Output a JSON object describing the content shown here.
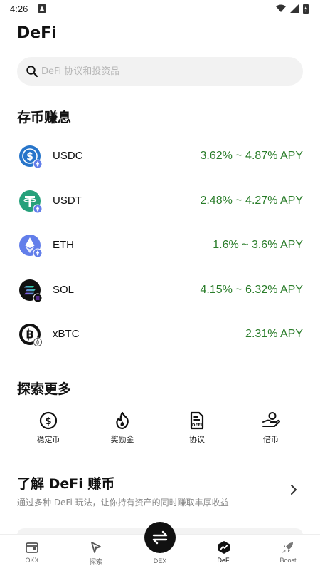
{
  "status_bar": {
    "time": "4:26"
  },
  "header": {
    "title": "DeFi"
  },
  "search": {
    "placeholder": "DeFi 协议和投资品"
  },
  "earn_section": {
    "title": "存币赚息",
    "assets": [
      {
        "name": "USDC",
        "apy": "3.62% ~ 4.87% APY",
        "icon": "usdc-coin-icon"
      },
      {
        "name": "USDT",
        "apy": "2.48% ~ 4.27% APY",
        "icon": "usdt-coin-icon"
      },
      {
        "name": "ETH",
        "apy": "1.6% ~ 3.6% APY",
        "icon": "eth-coin-icon"
      },
      {
        "name": "SOL",
        "apy": "4.15% ~ 6.32% APY",
        "icon": "sol-coin-icon"
      },
      {
        "name": "xBTC",
        "apy": "2.31% APY",
        "icon": "xbtc-coin-icon"
      }
    ]
  },
  "explore_section": {
    "title": "探索更多",
    "items": [
      {
        "label": "稳定币",
        "icon": "dollar-coin-icon"
      },
      {
        "label": "奖励金",
        "icon": "flame-icon"
      },
      {
        "label": "协议",
        "icon": "defi-document-icon"
      },
      {
        "label": "借币",
        "icon": "borrow-hand-icon"
      }
    ]
  },
  "learn_section": {
    "title": "了解 DeFi 赚币",
    "subtitle": "通过多种 DeFi 玩法，让你持有资产的同时赚取丰厚收益"
  },
  "tabbar": {
    "tabs": [
      {
        "label": "OKX",
        "icon": "wallet-icon"
      },
      {
        "label": "探索",
        "icon": "compass-icon"
      },
      {
        "label": "DEX",
        "icon": "swap-icon"
      },
      {
        "label": "DeFi",
        "icon": "defi-icon"
      },
      {
        "label": "Boost",
        "icon": "rocket-icon"
      }
    ],
    "active": "DeFi"
  },
  "colors": {
    "apy_green": "#2a7d2a",
    "usdc": "#2775ca",
    "usdt": "#26a17b",
    "eth": "#627eea",
    "text": "#111111"
  }
}
